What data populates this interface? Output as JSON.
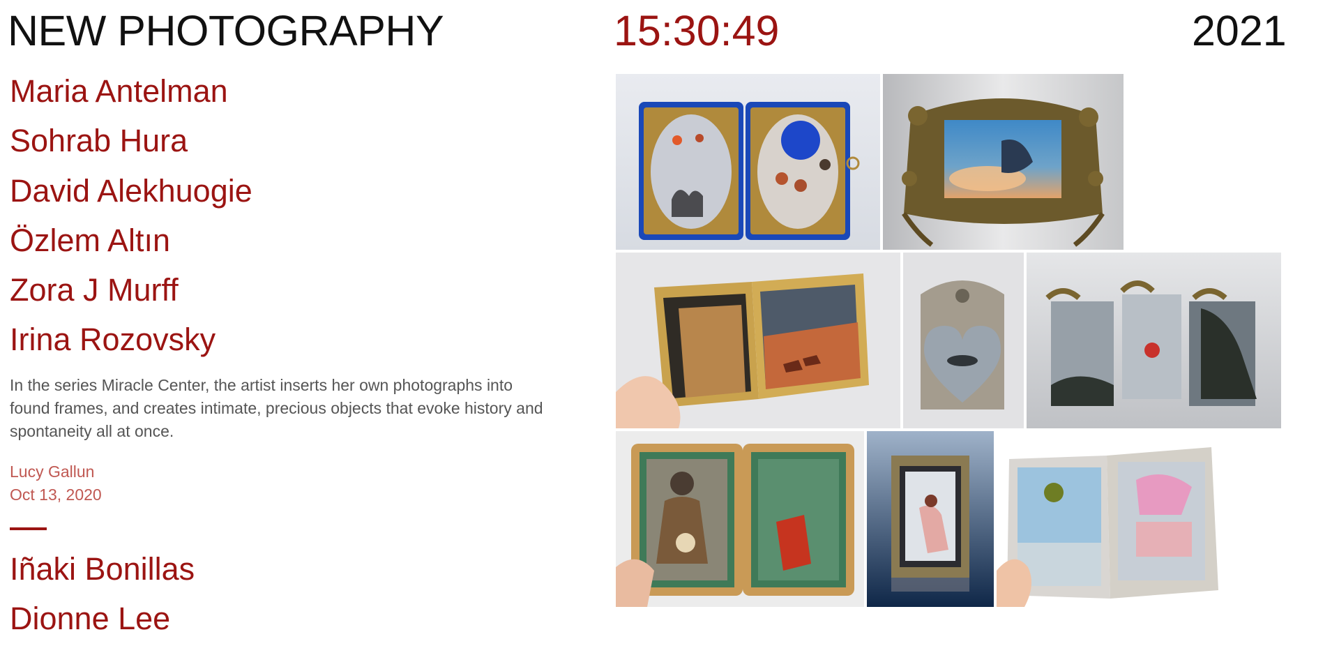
{
  "header": {
    "title": "NEW PHOTOGRAPHY",
    "clock": "15:30:49",
    "year": "2021"
  },
  "artists": [
    "Maria Antelman",
    "Sohrab Hura",
    "David Alekhuogie",
    "Özlem Altın",
    "Zora J Murff",
    "Irina Rozovsky"
  ],
  "feature": {
    "description": "In the series Miracle Center, the artist inserts her own photographs into found frames, and creates intimate, precious objects that evoke history and spontaneity all at once.",
    "author": "Lucy Gallun",
    "date": "Oct 13, 2020"
  },
  "more_artists": [
    "Iñaki Bonillas",
    "Dionne Lee"
  ],
  "colors": {
    "accent": "#9b1412",
    "meta": "#c05852",
    "body_text": "#555555",
    "title": "#111111"
  },
  "gallery": {
    "images": [
      {
        "name": "blue-diptych-frame-photo"
      },
      {
        "name": "ornate-brass-frame-photo"
      },
      {
        "name": "gold-diptych-in-hand-photo"
      },
      {
        "name": "heart-silver-frame-photo"
      },
      {
        "name": "triptych-glass-frame-photo"
      },
      {
        "name": "gold-green-diptych-photo"
      },
      {
        "name": "dark-jeweled-frame-photo"
      },
      {
        "name": "silver-diptych-in-hand-photo"
      }
    ]
  }
}
